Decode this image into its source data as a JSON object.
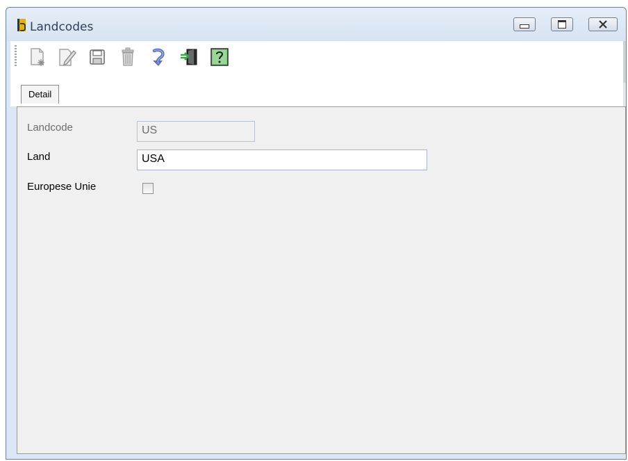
{
  "window": {
    "title": "Landcodes",
    "icon": "app-logo-icon"
  },
  "titlebar_buttons": [
    {
      "name": "minimize-button",
      "icon": "minimize-icon"
    },
    {
      "name": "maximize-button",
      "icon": "maximize-icon"
    },
    {
      "name": "close-button",
      "icon": "close-icon"
    }
  ],
  "toolbar": {
    "buttons": [
      {
        "name": "new-record-button",
        "icon": "new-document-icon",
        "enabled": false
      },
      {
        "name": "edit-record-button",
        "icon": "edit-pencil-icon",
        "enabled": false
      },
      {
        "name": "save-button",
        "icon": "save-disk-icon",
        "enabled": false
      },
      {
        "name": "delete-button",
        "icon": "trash-icon",
        "enabled": false
      },
      {
        "name": "undo-button",
        "icon": "undo-arrow-icon",
        "enabled": true
      },
      {
        "name": "exit-button",
        "icon": "exit-door-icon",
        "enabled": true
      },
      {
        "name": "help-button",
        "icon": "help-question-icon",
        "enabled": true
      }
    ]
  },
  "tabs": [
    {
      "label": "Detail",
      "active": true
    }
  ],
  "form": {
    "landcode_label": "Landcode",
    "landcode_value": "US",
    "land_label": "Land",
    "land_value": "USA",
    "europese_unie_label": "Europese Unie",
    "europese_unie_checked": false
  },
  "colors": {
    "accent": "#5a6fc0",
    "exit_green": "#3aa84a",
    "help_bg": "#7bc87b"
  }
}
